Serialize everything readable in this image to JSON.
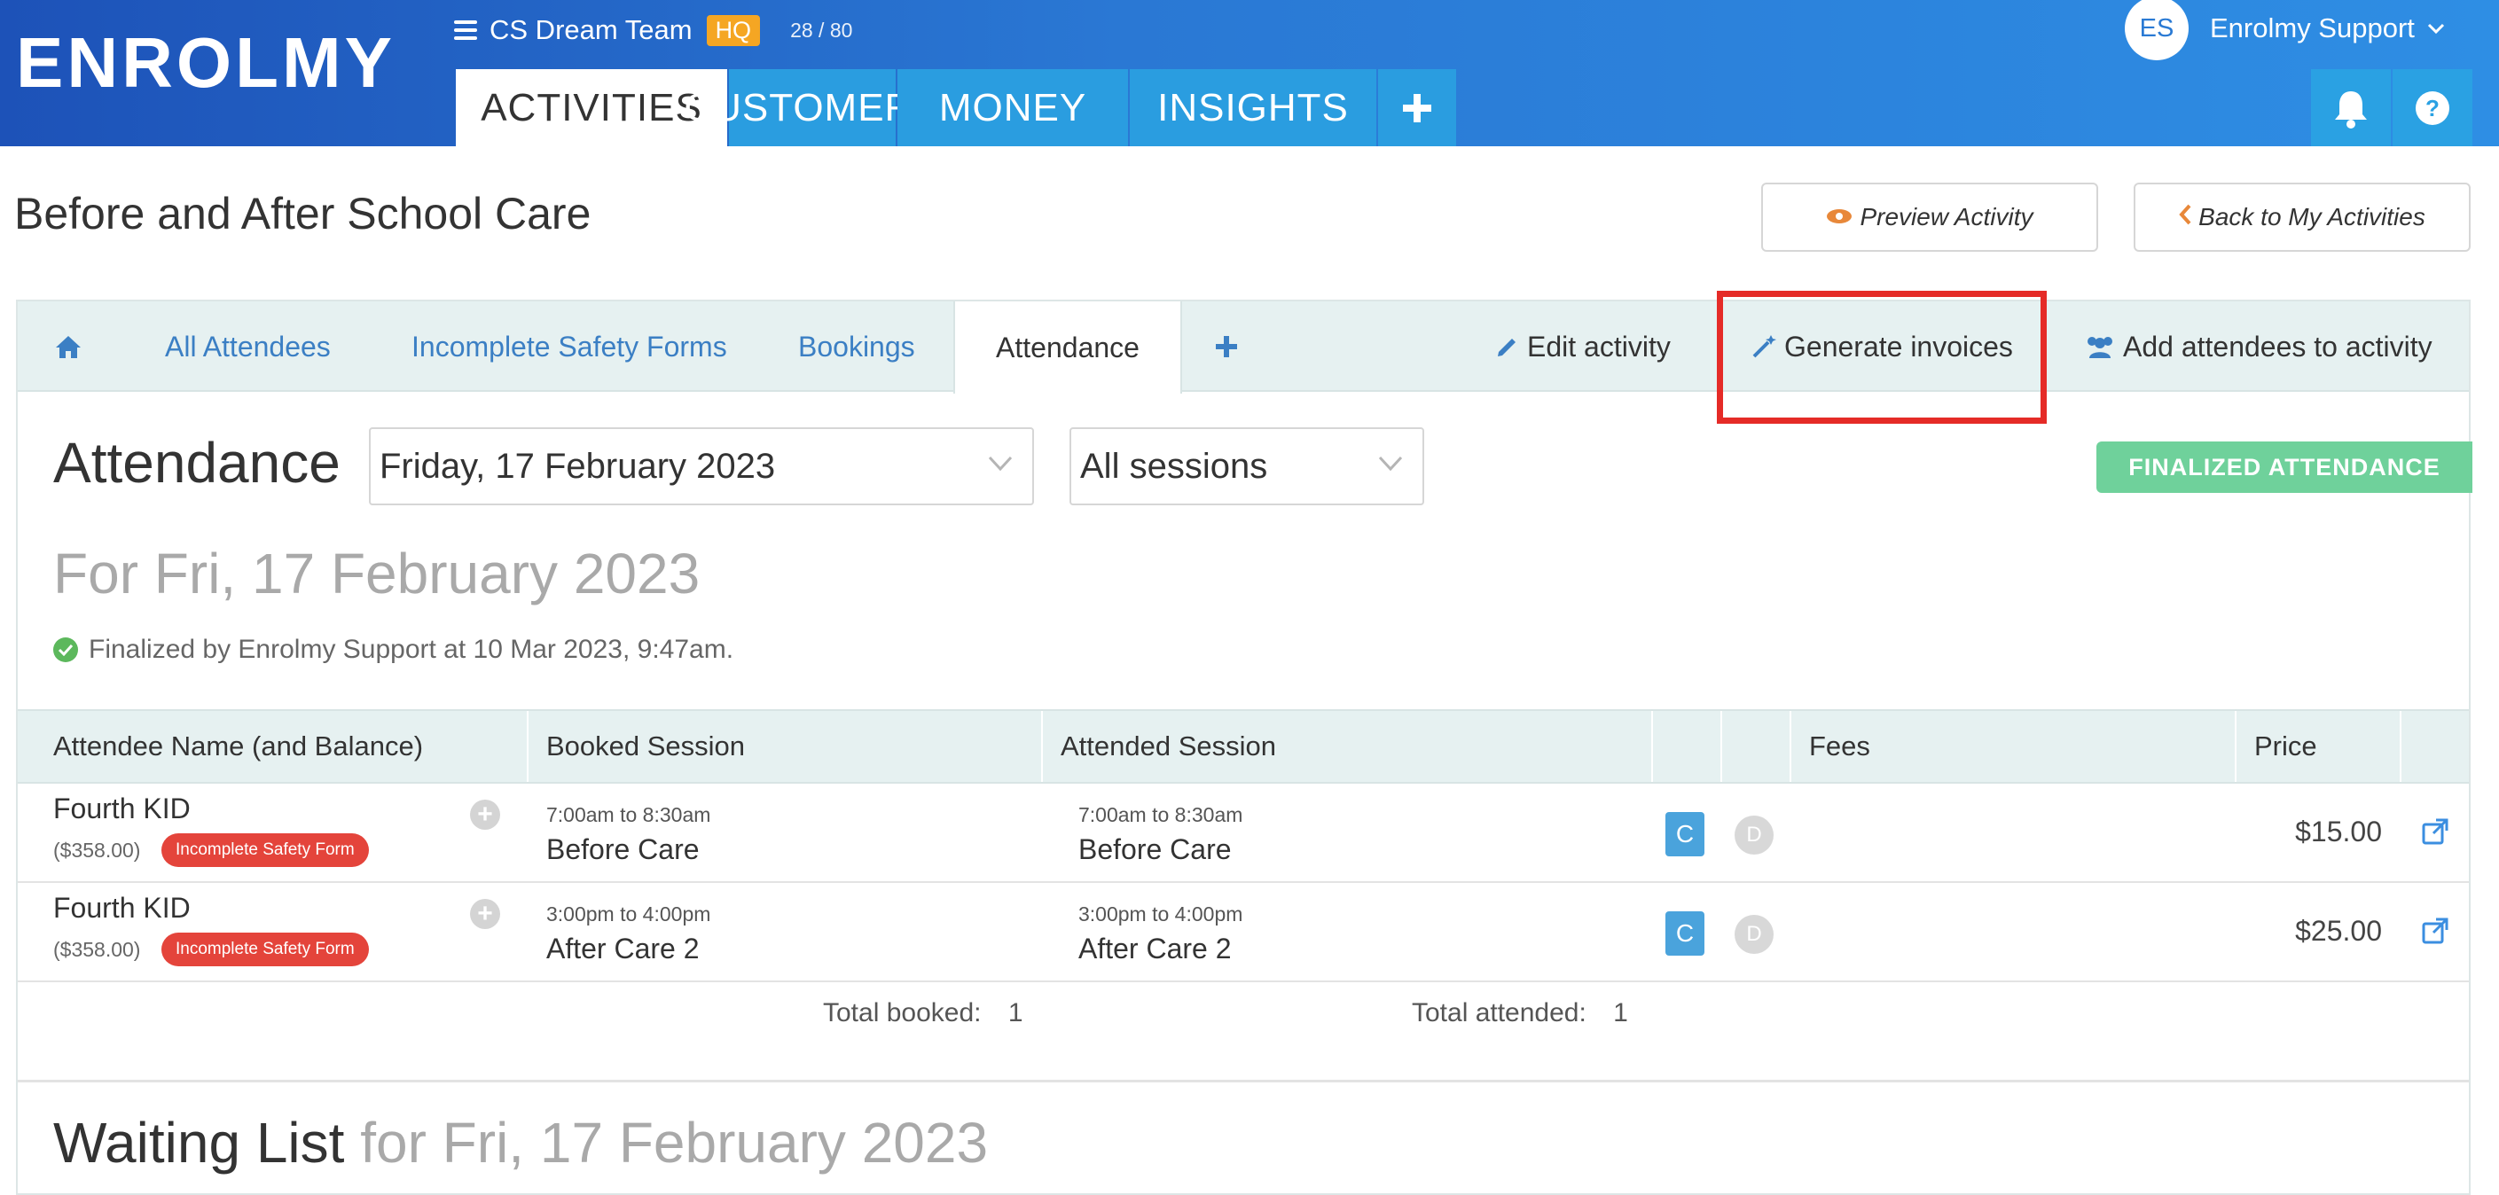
{
  "header": {
    "logo": "ENROLMY",
    "org_name": "CS Dream Team",
    "org_badge": "HQ",
    "org_count": "28 / 80",
    "nav_tabs": [
      {
        "label": "ACTIVITIES",
        "active": true
      },
      {
        "label": "CUSTOMERS",
        "active": false
      },
      {
        "label": "MONEY",
        "active": false
      },
      {
        "label": "INSIGHTS",
        "active": false
      }
    ],
    "nav_add_icon": "plus-icon",
    "user_initials": "ES",
    "user_name": "Enrolmy Support",
    "icons": [
      "bell-icon",
      "help-icon"
    ]
  },
  "page": {
    "title": "Before and After School Care",
    "preview_button": "Preview Activity",
    "back_button": "Back to My Activities"
  },
  "subnav": {
    "home_icon": "home-icon",
    "tabs": [
      "All Attendees",
      "Incomplete Safety Forms",
      "Bookings",
      "Attendance"
    ],
    "active_tab": "Attendance",
    "add_icon": "plus-icon",
    "edit_activity": "Edit activity",
    "generate_invoices": "Generate invoices",
    "add_attendees": "Add attendees to activity"
  },
  "attendance": {
    "title": "Attendance",
    "date_select": "Friday, 17 February 2023",
    "session_select": "All sessions",
    "finalized_button": "FINALIZED  ATTENDANCE",
    "for_date": "For Fri, 17 February 2023",
    "finalized_note": "Finalized by Enrolmy Support at 10 Mar 2023, 9:47am."
  },
  "table": {
    "headers": [
      "Attendee Name (and Balance)",
      "Booked Session",
      "Attended Session",
      "",
      "",
      "Fees",
      "Price",
      ""
    ],
    "rows": [
      {
        "name": "Fourth KID",
        "balance": "($358.00)",
        "badge": "Incomplete Safety Form",
        "booked_time": "7:00am to 8:30am",
        "booked_session": "Before Care",
        "attended_time": "7:00am to 8:30am",
        "attended_session": "Before Care",
        "c_label": "C",
        "d_label": "D",
        "price": "$15.00"
      },
      {
        "name": "Fourth KID",
        "balance": "($358.00)",
        "badge": "Incomplete Safety Form",
        "booked_time": "3:00pm to 4:00pm",
        "booked_session": "After Care 2",
        "attended_time": "3:00pm to 4:00pm",
        "attended_session": "After Care 2",
        "c_label": "C",
        "d_label": "D",
        "price": "$25.00"
      }
    ],
    "total_booked_label": "Total booked:",
    "total_booked": "1",
    "total_attended_label": "Total attended:",
    "total_attended": "1"
  },
  "waiting": {
    "title": "Waiting List",
    "date": "for Fri, 17 February 2023"
  },
  "colors": {
    "brand_blue": "#1d52b8",
    "tab_blue": "#2a9de0",
    "hq_orange": "#f5a623",
    "finalized_green": "#6fd19b",
    "badge_red": "#e4443b",
    "highlight_red": "#e52b27"
  }
}
